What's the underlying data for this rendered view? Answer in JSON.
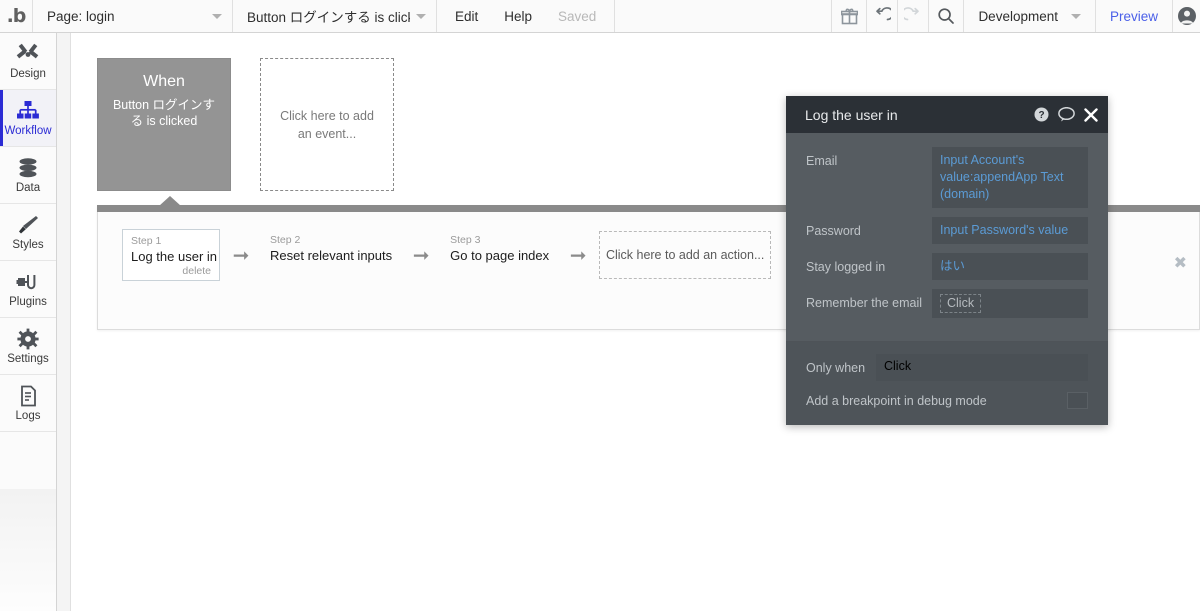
{
  "topbar": {
    "logo": "bubble-logo",
    "page_selector": {
      "label": "Page: login",
      "icon": "chevron-down-icon"
    },
    "event_selector": {
      "label": "Button ログインする is clicked",
      "icon": "chevron-down-icon"
    },
    "menu": [
      {
        "label": "Edit",
        "muted": false
      },
      {
        "label": "Help",
        "muted": false
      },
      {
        "label": "Saved",
        "muted": true
      }
    ],
    "icons": {
      "gift": "gift-icon",
      "undo": "undo-icon",
      "redo": "redo-icon",
      "search": "search-icon",
      "avatar": "user-avatar-icon"
    },
    "environment": {
      "label": "Development",
      "icon": "chevron-down-icon"
    },
    "preview": {
      "label": "Preview",
      "color": "#4a5fe8"
    }
  },
  "sidebar": {
    "items": [
      {
        "label": "Design",
        "icon": "design-icon",
        "active": false
      },
      {
        "label": "Workflow",
        "icon": "workflow-icon",
        "active": true
      },
      {
        "label": "Data",
        "icon": "database-icon",
        "active": false
      },
      {
        "label": "Styles",
        "icon": "paintbrush-icon",
        "active": false
      },
      {
        "label": "Plugins",
        "icon": "plugins-icon",
        "active": false
      },
      {
        "label": "Settings",
        "icon": "gear-icon",
        "active": false
      },
      {
        "label": "Logs",
        "icon": "document-icon",
        "active": false
      }
    ],
    "active_color": "#2b2bd4",
    "collapse_handle": "expand-panel-triangle-icon"
  },
  "canvas": {
    "event": {
      "title": "When",
      "subtitle": "Button ログインする is clicked",
      "bg_color": "#949494"
    },
    "add_event": {
      "label": "Click here to add an event..."
    },
    "steps_panel": {
      "close_icon": "close-icon",
      "steps": [
        {
          "num": "Step 1",
          "name": "Log the user in",
          "delete": "delete",
          "selected": true
        },
        {
          "num": "Step 2",
          "name": "Reset relevant inputs",
          "delete": "",
          "selected": false
        },
        {
          "num": "Step 3",
          "name": "Go to page index",
          "delete": "",
          "selected": false
        }
      ],
      "arrow_icon": "right-arrow-icon",
      "add_action": {
        "label": "Click here to add an action..."
      }
    }
  },
  "properties": {
    "title": "Log the user in",
    "header_icons": {
      "help": "help-circle-icon",
      "comment": "comment-bubble-icon",
      "close": "close-icon"
    },
    "fields": [
      {
        "label": "Email",
        "value": "Input Account's value:appendApp Text (domain)",
        "type": "value"
      },
      {
        "label": "Password",
        "value": "Input Password's value",
        "type": "value"
      },
      {
        "label": "Stay logged in",
        "value": "はい",
        "type": "value"
      },
      {
        "label": "Remember the email",
        "value": "Click",
        "type": "placeholder"
      }
    ],
    "only_when": {
      "label": "Only when",
      "value": "Click",
      "type": "placeholder"
    },
    "breakpoint": {
      "label": "Add a breakpoint in debug mode",
      "checked": false
    },
    "accent_color": "#5b9bd5",
    "bg_color": "#565c61",
    "header_bg": "#2b3036"
  }
}
